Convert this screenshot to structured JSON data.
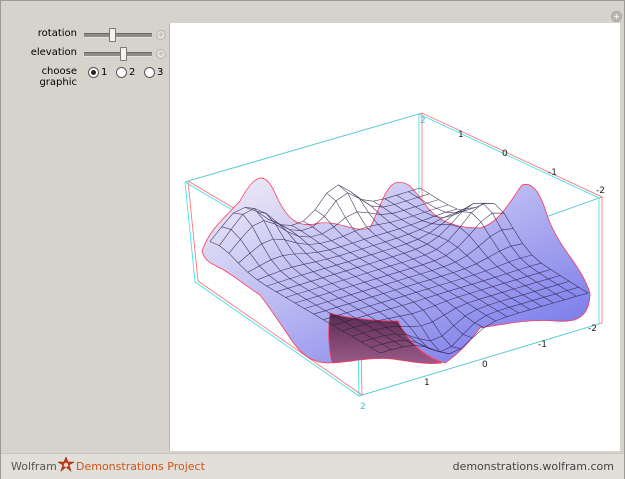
{
  "controls": {
    "rotation_label": "rotation",
    "rotation_value": 0.42,
    "elevation_label": "elevation",
    "elevation_value": 0.55,
    "choose_graphic_label": "choose graphic",
    "choose_graphic_options": [
      "1",
      "2",
      "3"
    ],
    "choose_graphic_selected": "1"
  },
  "plot": {
    "type": "3d-surface-anaglyph",
    "front_axis_ticks": [
      "2",
      "1",
      "0",
      "-1",
      "-2"
    ],
    "back_axis_ticks": [
      "2",
      "1",
      "0",
      "-1",
      "-2"
    ],
    "top_left_tick": "2",
    "bottom_corner_tick": "2",
    "colors": {
      "surface": "#8a8cf0",
      "mesh": "#2b1a4a",
      "red_offset": "#ff3030",
      "cyan_offset": "#20e8f0"
    }
  },
  "footer": {
    "brand": "Wolfram",
    "project": "Demonstrations Project",
    "url": "demonstrations.wolfram.com"
  },
  "icons": [
    "plus-icon",
    "wolfram-spikey-icon"
  ]
}
